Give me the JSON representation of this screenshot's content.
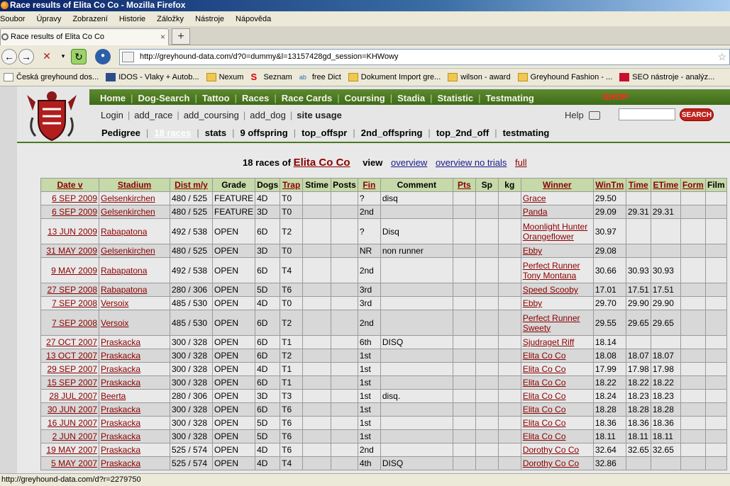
{
  "window": {
    "title": "Race results of Elita Co Co - Mozilla Firefox"
  },
  "menubar": [
    "Soubor",
    "Úpravy",
    "Zobrazení",
    "Historie",
    "Záložky",
    "Nástroje",
    "Nápověda"
  ],
  "tab": {
    "label": "Race results of Elita Co Co"
  },
  "url": "http://greyhound-data.com/d?0=dummy&l=13157428gd_session=KHWowy",
  "bookmarks": [
    {
      "label": "Česká greyhound dos...",
      "icon": "page-icon"
    },
    {
      "label": "IDOS - Vlaky + Autob...",
      "icon": "idos-icon"
    },
    {
      "label": "Nexum",
      "icon": "folder-icon"
    },
    {
      "label": "Seznam",
      "icon": "seznam-icon"
    },
    {
      "label": "free Dict",
      "icon": "dict-icon"
    },
    {
      "label": "Dokument Import gre...",
      "icon": "folder-icon"
    },
    {
      "label": "wilson - award",
      "icon": "folder-icon"
    },
    {
      "label": "Greyhound Fashion - ...",
      "icon": "folder-icon"
    },
    {
      "label": "SEO nástroje - analýz...",
      "icon": "seo-icon"
    }
  ],
  "site": {
    "nav": [
      "Home",
      "Dog-Search",
      "Tattoo",
      "Races",
      "Race Cards",
      "Coursing",
      "Stadia",
      "Statistic",
      "Testmating"
    ],
    "shop": "SHOP",
    "sub": [
      "Login",
      "add_race",
      "add_coursing",
      "add_dog"
    ],
    "sub_bold": "site usage",
    "help": "Help",
    "search_button": "SEARCH",
    "dog_nav": [
      "Pedigree",
      "18 races",
      "stats",
      "9 offspring",
      "top_offspr",
      "2nd_offspring",
      "top_2nd_off",
      "testmating"
    ]
  },
  "heading": {
    "prefix": "18 races of",
    "dog": "Elita Co Co",
    "view": "view",
    "links": [
      "overview",
      "overview no trials",
      "full"
    ]
  },
  "table": {
    "headers": [
      "Date v",
      "Stadium",
      "Dist m/y",
      "Grade",
      "Dogs",
      "Trap",
      "Stime",
      "Posts",
      "Fin",
      "Comment",
      "Pts",
      "Sp",
      "kg",
      "Winner",
      "WinTm",
      "Time",
      "ETime",
      "Form",
      "Film"
    ],
    "rows": [
      {
        "date": "6 SEP 2009",
        "stadium": "Gelsenkirchen",
        "dist": "480 / 525",
        "grade": "FEATURE",
        "dogs": "4D",
        "trap": "T0",
        "fin": "?",
        "comment": "disq",
        "winner": [
          "Grace"
        ],
        "wintm": "29.50",
        "time": "",
        "etime": ""
      },
      {
        "date": "6 SEP 2009",
        "stadium": "Gelsenkirchen",
        "dist": "480 / 525",
        "grade": "FEATURE",
        "dogs": "3D",
        "trap": "T0",
        "fin": "2nd",
        "comment": "",
        "winner": [
          "Panda"
        ],
        "wintm": "29.09",
        "time": "29.31",
        "etime": "29.31"
      },
      {
        "date": "13 JUN 2009",
        "stadium": "Rabapatona",
        "dist": "492 / 538",
        "grade": "OPEN",
        "dogs": "6D",
        "trap": "T2",
        "fin": "?",
        "comment": "Disq",
        "winner": [
          "Moonlight Hunter",
          "Orangeflower"
        ],
        "wintm": "30.97",
        "time": "",
        "etime": ""
      },
      {
        "date": "31 MAY 2009",
        "stadium": "Gelsenkirchen",
        "dist": "480 / 525",
        "grade": "OPEN",
        "dogs": "3D",
        "trap": "T0",
        "fin": "NR",
        "comment": "non runner",
        "winner": [
          "Ebby"
        ],
        "wintm": "29.08",
        "time": "",
        "etime": ""
      },
      {
        "date": "9 MAY 2009",
        "stadium": "Rabapatona",
        "dist": "492 / 538",
        "grade": "OPEN",
        "dogs": "6D",
        "trap": "T4",
        "fin": "2nd",
        "comment": "",
        "winner": [
          "Perfect Runner",
          "Tony Montana"
        ],
        "wintm": "30.66",
        "time": "30.93",
        "etime": "30.93"
      },
      {
        "date": "27 SEP 2008",
        "stadium": "Rabapatona",
        "dist": "280 / 306",
        "grade": "OPEN",
        "dogs": "5D",
        "trap": "T6",
        "fin": "3rd",
        "comment": "",
        "winner": [
          "Speed Scooby"
        ],
        "wintm": "17.01",
        "time": "17.51",
        "etime": "17.51"
      },
      {
        "date": "7 SEP 2008",
        "stadium": "Versoix",
        "dist": "485 / 530",
        "grade": "OPEN",
        "dogs": "4D",
        "trap": "T0",
        "fin": "3rd",
        "comment": "",
        "winner": [
          "Ebby"
        ],
        "wintm": "29.70",
        "time": "29.90",
        "etime": "29.90"
      },
      {
        "date": "7 SEP 2008",
        "stadium": "Versoix",
        "dist": "485 / 530",
        "grade": "OPEN",
        "dogs": "6D",
        "trap": "T2",
        "fin": "2nd",
        "comment": "",
        "winner": [
          "Perfect Runner",
          "Sweety"
        ],
        "wintm": "29.55",
        "time": "29.65",
        "etime": "29.65"
      },
      {
        "date": "27 OCT 2007",
        "stadium": "Praskacka",
        "dist": "300 / 328",
        "grade": "OPEN",
        "dogs": "6D",
        "trap": "T1",
        "fin": "6th",
        "comment": "DISQ",
        "winner": [
          "Sjudraget Riff"
        ],
        "wintm": "18.14",
        "time": "",
        "etime": ""
      },
      {
        "date": "13 OCT 2007",
        "stadium": "Praskacka",
        "dist": "300 / 328",
        "grade": "OPEN",
        "dogs": "6D",
        "trap": "T2",
        "fin": "1st",
        "comment": "",
        "winner": [
          "Elita Co Co"
        ],
        "wintm": "18.08",
        "time": "18.07",
        "etime": "18.07"
      },
      {
        "date": "29 SEP 2007",
        "stadium": "Praskacka",
        "dist": "300 / 328",
        "grade": "OPEN",
        "dogs": "4D",
        "trap": "T1",
        "fin": "1st",
        "comment": "",
        "winner": [
          "Elita Co Co"
        ],
        "wintm": "17.99",
        "time": "17.98",
        "etime": "17.98"
      },
      {
        "date": "15 SEP 2007",
        "stadium": "Praskacka",
        "dist": "300 / 328",
        "grade": "OPEN",
        "dogs": "6D",
        "trap": "T1",
        "fin": "1st",
        "comment": "",
        "winner": [
          "Elita Co Co"
        ],
        "wintm": "18.22",
        "time": "18.22",
        "etime": "18.22"
      },
      {
        "date": "28 JUL 2007",
        "stadium": "Beerta",
        "dist": "280 / 306",
        "grade": "OPEN",
        "dogs": "3D",
        "trap": "T3",
        "fin": "1st",
        "comment": "disq.",
        "winner": [
          "Elita Co Co"
        ],
        "wintm": "18.24",
        "time": "18.23",
        "etime": "18.23"
      },
      {
        "date": "30 JUN 2007",
        "stadium": "Praskacka",
        "dist": "300 / 328",
        "grade": "OPEN",
        "dogs": "6D",
        "trap": "T6",
        "fin": "1st",
        "comment": "",
        "winner": [
          "Elita Co Co"
        ],
        "wintm": "18.28",
        "time": "18.28",
        "etime": "18.28"
      },
      {
        "date": "16 JUN 2007",
        "stadium": "Praskacka",
        "dist": "300 / 328",
        "grade": "OPEN",
        "dogs": "5D",
        "trap": "T6",
        "fin": "1st",
        "comment": "",
        "winner": [
          "Elita Co Co"
        ],
        "wintm": "18.36",
        "time": "18.36",
        "etime": "18.36"
      },
      {
        "date": "2 JUN 2007",
        "stadium": "Praskacka",
        "dist": "300 / 328",
        "grade": "OPEN",
        "dogs": "5D",
        "trap": "T6",
        "fin": "1st",
        "comment": "",
        "winner": [
          "Elita Co Co"
        ],
        "wintm": "18.11",
        "time": "18.11",
        "etime": "18.11"
      },
      {
        "date": "19 MAY 2007",
        "stadium": "Praskacka",
        "dist": "525 / 574",
        "grade": "OPEN",
        "dogs": "4D",
        "trap": "T6",
        "fin": "2nd",
        "comment": "",
        "winner": [
          "Dorothy Co Co"
        ],
        "wintm": "32.64",
        "time": "32.65",
        "etime": "32.65"
      },
      {
        "date": "5 MAY 2007",
        "stadium": "Praskacka",
        "dist": "525 / 574",
        "grade": "OPEN",
        "dogs": "4D",
        "trap": "T4",
        "fin": "4th",
        "comment": "DISQ",
        "winner": [
          "Dorothy Co Co"
        ],
        "wintm": "32.86",
        "time": "",
        "etime": ""
      }
    ]
  },
  "statusbar": "http://greyhound-data.com/d?r=2279750",
  "colors": {
    "nav_green": "#4a7a22",
    "header_green": "#c6d9a8",
    "link_red": "#8b0000",
    "shop_red": "#ff2a1a"
  }
}
